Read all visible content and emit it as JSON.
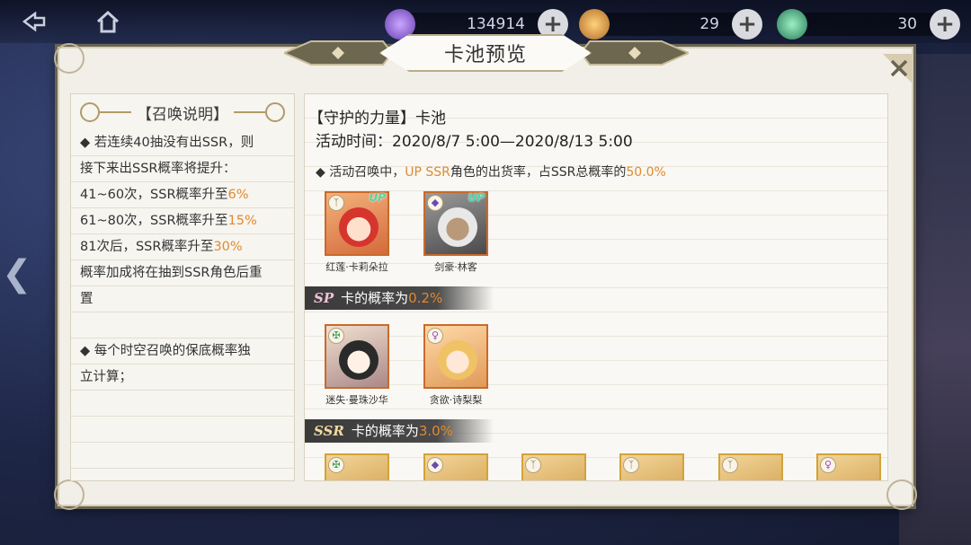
{
  "topbar": {
    "resources": [
      {
        "icon": "crystal-icon",
        "value": "134914"
      },
      {
        "icon": "summon-orb-icon",
        "value": "29"
      },
      {
        "icon": "ticket-icon",
        "value": "30"
      }
    ]
  },
  "panel": {
    "title": "卡池预览"
  },
  "left": {
    "header": "【召唤说明】",
    "para1_line1": "◆ 若连续40抽没有出SSR，则",
    "para1_line2": "接下来出SSR概率将提升：",
    "r1_prefix": "41~60次，SSR概率升至",
    "r1_value": "6%",
    "r2_prefix": "61~80次，SSR概率升至",
    "r2_value": "15%",
    "r3_prefix": "81次后，SSR概率升至",
    "r3_value": "30%",
    "para2_line1": "概率加成将在抽到SSR角色后重",
    "para2_line2": "置",
    "para3_line1": "◆ 每个时空召唤的保底概率独",
    "para3_line2": "立计算；"
  },
  "right": {
    "pool_name": "【守护的力量】卡池",
    "pool_time": "活动时间：2020/8/7  5:00—2020/8/13  5:00",
    "up_note_prefix": "◆  活动召唤中，",
    "up_note_highlight": "UP SSR",
    "up_note_mid": "角色的出货率，占SSR总概率的",
    "up_note_value": "50.0%",
    "up_cards": [
      {
        "name": "红莲·卡莉朵拉",
        "badge": "UP"
      },
      {
        "name": "剑豪·林客",
        "badge": "UP"
      }
    ],
    "sp_banner": {
      "tag": "SP",
      "text": "卡的概率为",
      "value": "0.2%"
    },
    "sp_cards": [
      {
        "name": "迷失·曼珠沙华"
      },
      {
        "name": "贪欲·诗梨梨"
      }
    ],
    "ssr_banner": {
      "tag": "SSR",
      "text": "卡的概率为",
      "value": "3.0%"
    }
  },
  "colors": {
    "accent_orange": "#e08a2f",
    "panel_bg": "#f2efe8",
    "banner_bg": "#3a3a3a"
  }
}
